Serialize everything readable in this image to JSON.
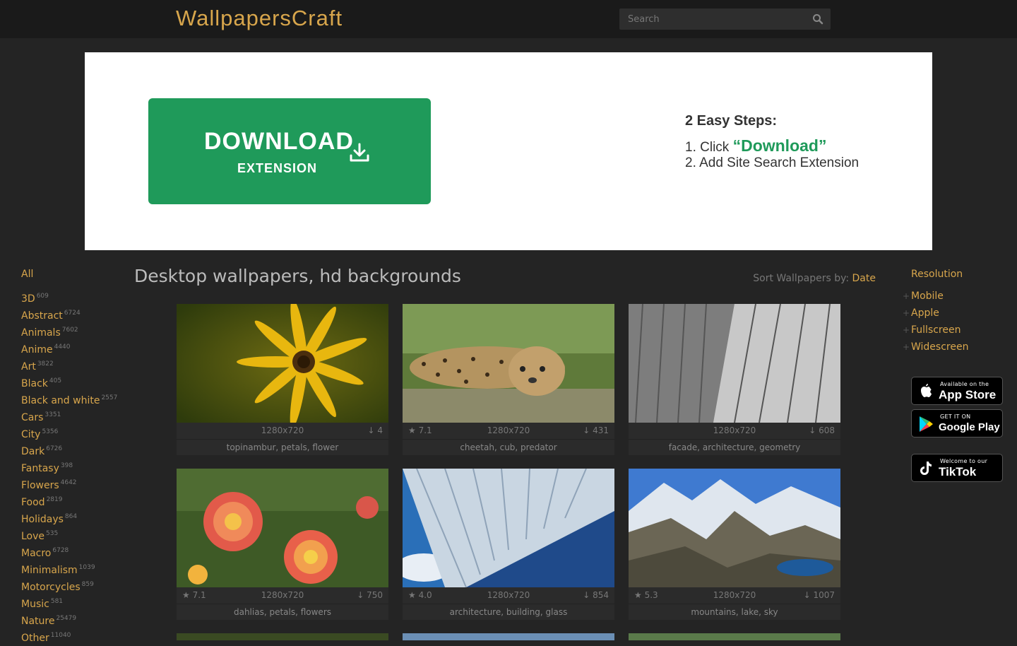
{
  "header": {
    "logo": "WallpapersCraft",
    "search_placeholder": "Search"
  },
  "banner": {
    "download_label": "DOWNLOAD",
    "extension_label": "EXTENSION",
    "steps_title": "2 Easy Steps:",
    "step1_prefix": "1. Click ",
    "step1_highlight": "“Download”",
    "step2": "2. Add Site Search Extension"
  },
  "left_nav": {
    "all": "All",
    "items": [
      {
        "label": "3D",
        "count": "609"
      },
      {
        "label": "Abstract",
        "count": "6724"
      },
      {
        "label": "Animals",
        "count": "7602"
      },
      {
        "label": "Anime",
        "count": "4440"
      },
      {
        "label": "Art",
        "count": "3822"
      },
      {
        "label": "Black",
        "count": "405"
      },
      {
        "label": "Black and white",
        "count": "2557"
      },
      {
        "label": "Cars",
        "count": "3351"
      },
      {
        "label": "City",
        "count": "5356"
      },
      {
        "label": "Dark",
        "count": "6726"
      },
      {
        "label": "Fantasy",
        "count": "398"
      },
      {
        "label": "Flowers",
        "count": "4642"
      },
      {
        "label": "Food",
        "count": "2819"
      },
      {
        "label": "Holidays",
        "count": "864"
      },
      {
        "label": "Love",
        "count": "535"
      },
      {
        "label": "Macro",
        "count": "6728"
      },
      {
        "label": "Minimalism",
        "count": "1039"
      },
      {
        "label": "Motorcycles",
        "count": "859"
      },
      {
        "label": "Music",
        "count": "581"
      },
      {
        "label": "Nature",
        "count": "25479"
      },
      {
        "label": "Other",
        "count": "11040"
      }
    ]
  },
  "main": {
    "title": "Desktop wallpapers, hd backgrounds",
    "sort_label": "Sort Wallpapers by: ",
    "sort_value": "Date",
    "cards": [
      {
        "rating": "",
        "resolution": "1280x720",
        "downloads": "4",
        "tags": "topinambur, petals, flower"
      },
      {
        "rating": "7.1",
        "resolution": "1280x720",
        "downloads": "431",
        "tags": "cheetah, cub, predator"
      },
      {
        "rating": "",
        "resolution": "1280x720",
        "downloads": "608",
        "tags": "facade, architecture, geometry"
      },
      {
        "rating": "7.1",
        "resolution": "1280x720",
        "downloads": "750",
        "tags": "dahlias, petals, flowers"
      },
      {
        "rating": "4.0",
        "resolution": "1280x720",
        "downloads": "854",
        "tags": "architecture, building, glass"
      },
      {
        "rating": "5.3",
        "resolution": "1280x720",
        "downloads": "1007",
        "tags": "mountains, lake, sky"
      }
    ]
  },
  "right_nav": {
    "heading": "Resolution",
    "items": [
      "Mobile",
      "Apple",
      "Fullscreen",
      "Widescreen"
    ],
    "appstore_small": "Available on the",
    "appstore_big": "App Store",
    "googleplay_small": "GET IT ON",
    "googleplay_big": "Google Play",
    "tiktok_small": "Welcome to our",
    "tiktok_big": "TikTok"
  },
  "colors": {
    "accent": "#d8a64c",
    "background": "#242424",
    "header": "#1a1a1a",
    "download_green": "#1f9a5a"
  }
}
